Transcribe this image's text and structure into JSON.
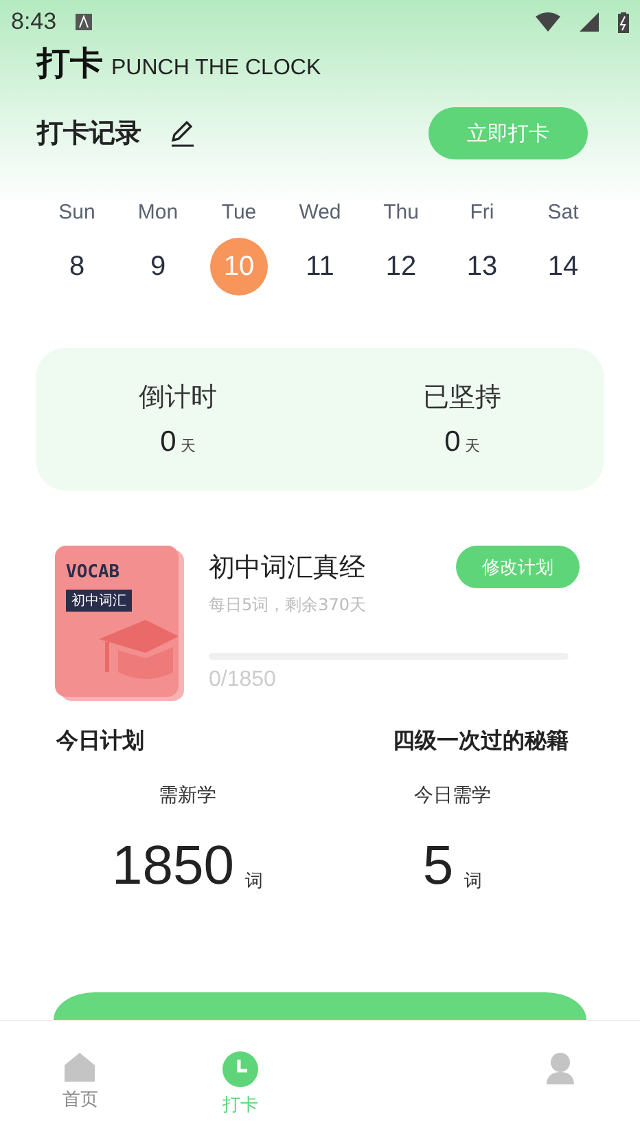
{
  "status_bar": {
    "time": "8:43"
  },
  "header": {
    "title": "打卡",
    "subtitle": "PUNCH THE CLOCK"
  },
  "record": {
    "title": "打卡记录",
    "button": "立即打卡"
  },
  "calendar": [
    {
      "day": "Sun",
      "date": "8",
      "selected": false
    },
    {
      "day": "Mon",
      "date": "9",
      "selected": false
    },
    {
      "day": "Tue",
      "date": "10",
      "selected": true
    },
    {
      "day": "Wed",
      "date": "11",
      "selected": false
    },
    {
      "day": "Thu",
      "date": "12",
      "selected": false
    },
    {
      "day": "Fri",
      "date": "13",
      "selected": false
    },
    {
      "day": "Sat",
      "date": "14",
      "selected": false
    }
  ],
  "counters": [
    {
      "label": "倒计时",
      "value": "0",
      "unit": "天"
    },
    {
      "label": "已坚持",
      "value": "0",
      "unit": "天"
    }
  ],
  "book": {
    "cover_title": "VOCAB",
    "cover_tag": "初中词汇",
    "title": "初中词汇真经",
    "subtitle": "每日5词，剩余370天",
    "level": 0,
    "progress": "0/1850",
    "button": "修改计划"
  },
  "plan": {
    "title": "今日计划",
    "link": "四级一次过的秘籍"
  },
  "stats": [
    {
      "label": "需新学",
      "value": "1850",
      "unit": "词"
    },
    {
      "label": "今日需学",
      "value": "5",
      "unit": "词"
    }
  ],
  "nav": [
    {
      "label": "首页",
      "kind": "home",
      "selected": false
    },
    {
      "label": "打卡",
      "kind": "clock",
      "selected": true
    },
    {
      "kind": "person",
      "selected": false
    }
  ]
}
